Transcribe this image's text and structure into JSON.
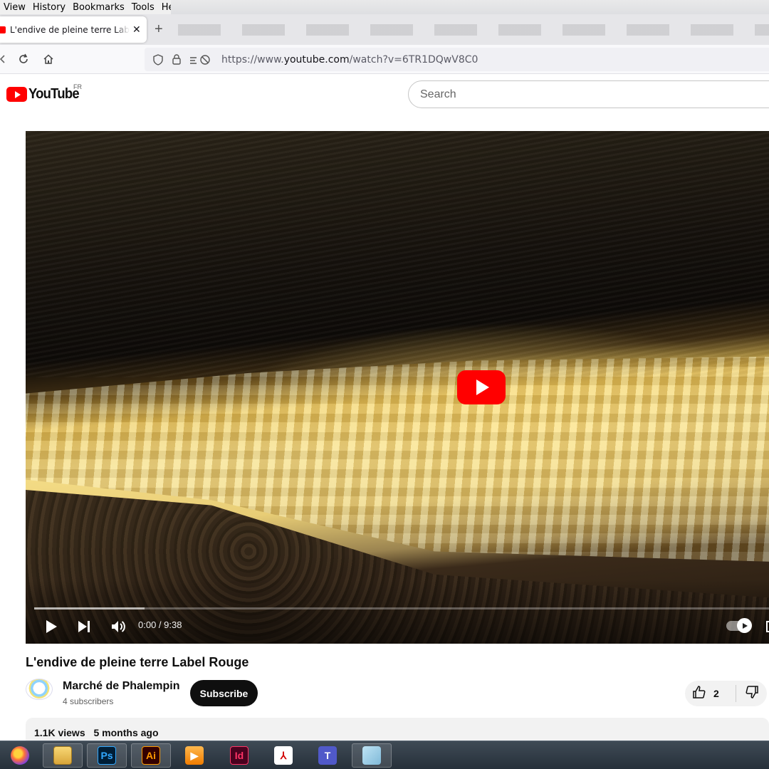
{
  "menubar": {
    "items": [
      {
        "label": "View"
      },
      {
        "label": "History"
      },
      {
        "label": "Bookmarks"
      },
      {
        "label": "Tools"
      },
      {
        "label": "Help"
      }
    ]
  },
  "tabs": {
    "active_title": "L'endive de pleine terre Label Rouge",
    "close_glyph": "✕",
    "new_tab_glyph": "+"
  },
  "navbar": {
    "url_prefix": "https://www.",
    "url_domain": "youtube.com",
    "url_path": "/watch?v=6TR1DQwV8C0",
    "icons": [
      "back-icon",
      "reload-icon",
      "home-icon",
      "shield-icon",
      "lock-icon",
      "permissions-icon"
    ]
  },
  "youtube": {
    "logo_text": "YouTube",
    "country_code": "FR",
    "search_placeholder": "Search"
  },
  "player": {
    "time_display": "0:00 / 9:38",
    "loaded_fraction": 0.15,
    "brand_color": "#ff0000"
  },
  "video": {
    "title": "L'endive de pleine terre Label Rouge",
    "channel_name": "Marché de Phalempin",
    "subscribers": "4 subscribers",
    "subscribe_label": "Subscribe",
    "like_count": "2",
    "views": "1.1K views",
    "age": "5 months ago"
  },
  "taskbar": {
    "apps": [
      {
        "name": "firefox",
        "glyph": ""
      },
      {
        "name": "file-explorer",
        "glyph": ""
      },
      {
        "name": "photoshop",
        "glyph": "Ps"
      },
      {
        "name": "illustrator",
        "glyph": "Ai"
      },
      {
        "name": "video-player",
        "glyph": "▶"
      },
      {
        "name": "indesign",
        "glyph": "Id"
      },
      {
        "name": "acrobat",
        "glyph": "⅄"
      },
      {
        "name": "teams",
        "glyph": "T"
      },
      {
        "name": "notes",
        "glyph": ""
      }
    ]
  }
}
